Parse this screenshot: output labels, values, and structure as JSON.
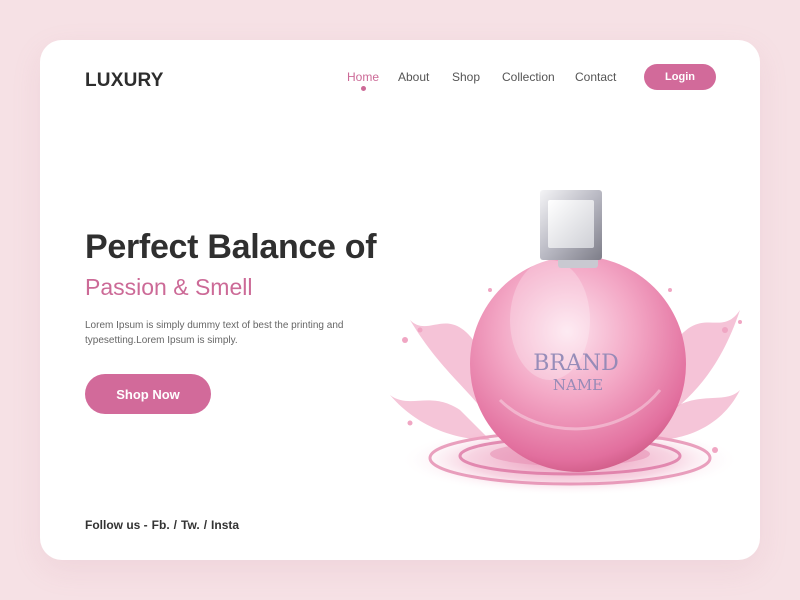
{
  "header": {
    "logo": "LUXURY",
    "nav": [
      "Home",
      "About",
      "Shop",
      "Collection",
      "Contact"
    ],
    "active_index": 0,
    "login_label": "Login"
  },
  "hero": {
    "title": "Perfect Balance of",
    "subtitle": "Passion & Smell",
    "description": "Lorem Ipsum is simply dummy text of best the printing and typesetting.Lorem Ipsum is simply.",
    "cta_label": "Shop Now"
  },
  "product": {
    "label_line1": "BRAND",
    "label_line2": "NAME"
  },
  "footer": {
    "follow_prefix": "Follow us -",
    "links": [
      "Fb.",
      "/",
      "Tw.",
      "/",
      "Insta"
    ]
  },
  "colors": {
    "background": "#f6e1e5",
    "accent": "#d26a9a",
    "text": "#2f2f2f"
  }
}
